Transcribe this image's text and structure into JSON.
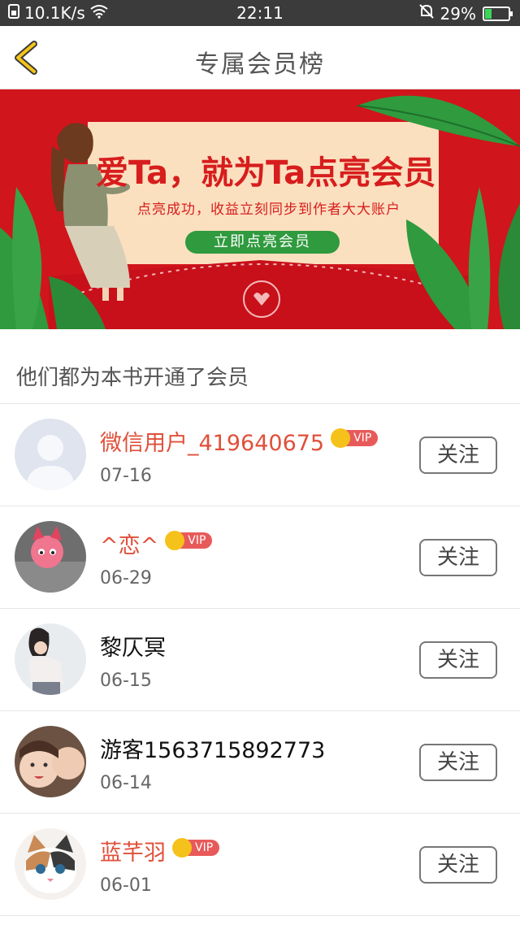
{
  "status_bar": {
    "network_speed": "10.1K/s",
    "time": "22:11",
    "battery_percent": "29%",
    "battery_level": 0.29
  },
  "header": {
    "title": "专属会员榜"
  },
  "banner": {
    "title": "爱Ta，就为Ta点亮会员",
    "subtitle": "点亮成功，收益立刻同步到作者大大账户",
    "button_label": "立即点亮会员"
  },
  "section": {
    "heading": "他们都为本书开通了会员"
  },
  "members": [
    {
      "name": "微信用户_419640675",
      "vip": true,
      "vip_label": "VIP",
      "date": "07-16",
      "follow_label": "关注"
    },
    {
      "name": "^恋^",
      "vip": true,
      "vip_label": "VIP",
      "date": "06-29",
      "follow_label": "关注"
    },
    {
      "name": "黎仄冥",
      "vip": false,
      "date": "06-15",
      "follow_label": "关注"
    },
    {
      "name": "游客1563715892773",
      "vip": false,
      "date": "06-14",
      "follow_label": "关注"
    },
    {
      "name": "蓝芊羽",
      "vip": true,
      "vip_label": "VIP",
      "date": "06-01",
      "follow_label": "关注"
    }
  ],
  "colors": {
    "banner_red": "#d0151c",
    "vip_name": "#e0503a",
    "button_green": "#2f9a3e"
  }
}
